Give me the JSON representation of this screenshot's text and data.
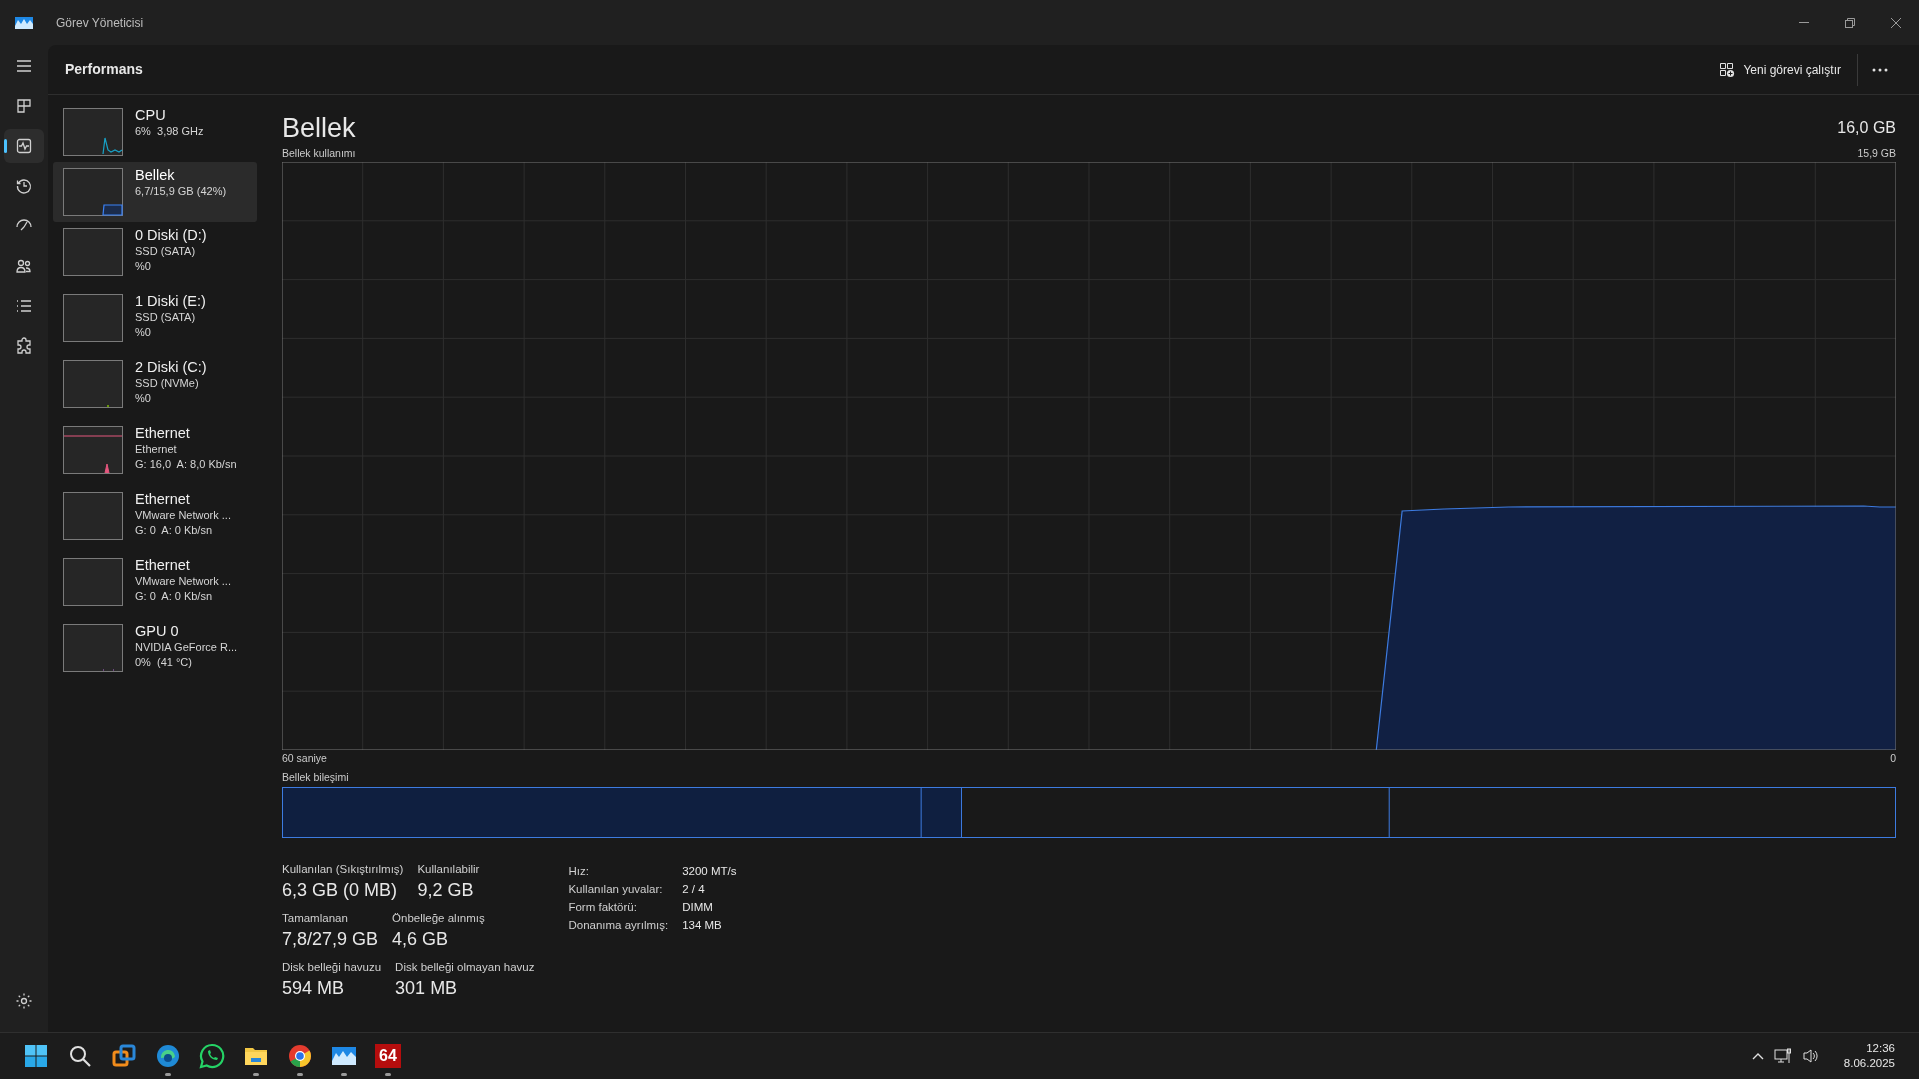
{
  "window": {
    "title": "Görev Yöneticisi"
  },
  "nav": [
    {
      "kind": "menu",
      "selected": false
    },
    {
      "kind": "processes",
      "selected": false
    },
    {
      "kind": "performance",
      "selected": true
    },
    {
      "kind": "history",
      "selected": false
    },
    {
      "kind": "startup",
      "selected": false
    },
    {
      "kind": "users",
      "selected": false
    },
    {
      "kind": "details",
      "selected": false
    },
    {
      "kind": "services",
      "selected": false
    },
    {
      "kind": "settings",
      "selected": false
    }
  ],
  "header": {
    "title": "Performans",
    "run_task": "Yeni görevi çalıştır"
  },
  "devices": [
    {
      "kind": "cpu",
      "title": "CPU",
      "lines": [
        "6%  3,98 GHz"
      ],
      "selected": false
    },
    {
      "kind": "memory",
      "title": "Bellek",
      "lines": [
        "6,7/15,9 GB (42%)"
      ],
      "selected": true
    },
    {
      "kind": "disk",
      "title": "0 Diski (D:)",
      "lines": [
        "SSD (SATA)",
        "%0"
      ],
      "selected": false
    },
    {
      "kind": "disk",
      "title": "1 Diski (E:)",
      "lines": [
        "SSD (SATA)",
        "%0"
      ],
      "selected": false
    },
    {
      "kind": "disk_active",
      "title": "2 Diski (C:)",
      "lines": [
        "SSD (NVMe)",
        "%0"
      ],
      "selected": false
    },
    {
      "kind": "ethernet_active",
      "title": "Ethernet",
      "lines": [
        "Ethernet",
        "G: 16,0  A: 8,0 Kb/sn"
      ],
      "selected": false
    },
    {
      "kind": "ethernet",
      "title": "Ethernet",
      "lines": [
        "VMware Network ...",
        "G: 0  A: 0 Kb/sn"
      ],
      "selected": false
    },
    {
      "kind": "ethernet",
      "title": "Ethernet",
      "lines": [
        "VMware Network ...",
        "G: 0  A: 0 Kb/sn"
      ],
      "selected": false
    },
    {
      "kind": "gpu",
      "title": "GPU 0",
      "lines": [
        "NVIDIA GeForce R...",
        "0%  (41 °C)"
      ],
      "selected": false
    }
  ],
  "main": {
    "title": "Bellek",
    "total": "16,0 GB",
    "chart_label": "Bellek kullanımı",
    "chart_max": "15,9 GB",
    "x_start": "60 saniye",
    "x_end": "0",
    "composition_label": "Bellek bileşimi",
    "composition": [
      {
        "kind": "filled"
      },
      {
        "kind": "filled"
      },
      {
        "kind": "empty"
      },
      {
        "kind": "empty"
      }
    ],
    "stats": [
      [
        {
          "label": "Kullanılan (Sıkıştırılmış)",
          "value": "6,3 GB (0 MB)"
        },
        {
          "label": "Kullanılabilir",
          "value": "9,2 GB"
        }
      ],
      [
        {
          "label": "Tamamlanan",
          "value": "7,8/27,9 GB"
        },
        {
          "label": "Önbelleğe alınmış",
          "value": "4,6 GB"
        }
      ],
      [
        {
          "label": "Disk belleği havuzu",
          "value": "594 MB"
        },
        {
          "label": "Disk belleği olmayan havuz",
          "value": "301 MB"
        }
      ]
    ],
    "details": [
      {
        "label": "Hız:",
        "value": "3200 MT/s"
      },
      {
        "label": "Kullanılan yuvalar:",
        "value": "2 / 4"
      },
      {
        "label": "Form faktörü:",
        "value": "DIMM"
      },
      {
        "label": "Donanıma ayrılmış:",
        "value": "134 MB"
      }
    ]
  },
  "taskbar": {
    "apps": [
      {
        "kind": "start",
        "running": false
      },
      {
        "kind": "search",
        "running": false
      },
      {
        "kind": "vm",
        "running": false
      },
      {
        "kind": "edge",
        "running": true
      },
      {
        "kind": "whatsapp",
        "running": false
      },
      {
        "kind": "folder",
        "running": true
      },
      {
        "kind": "chrome",
        "running": true
      },
      {
        "kind": "taskmgr",
        "running": true
      },
      {
        "kind": "aida",
        "label": "64",
        "running": true
      }
    ],
    "time": "12:36",
    "date": "8.06.2025"
  }
}
